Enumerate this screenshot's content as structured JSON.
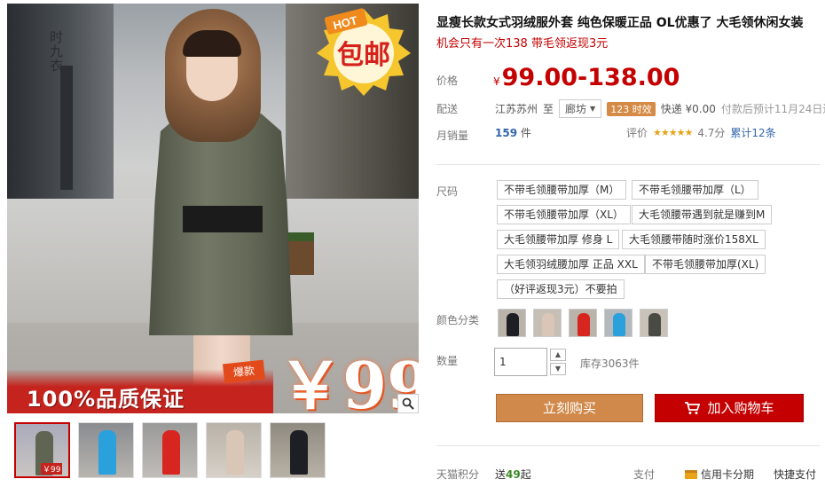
{
  "product": {
    "title": "显瘦长款女式羽绒服外套 纯色保暖正品 OL优惠了 大毛领休闲女装",
    "subtitle": "机会只有一次138 带毛领返现3元"
  },
  "image": {
    "brand_text": "时九衣",
    "hot_badge_top": "HOT",
    "hot_badge_main": "包邮",
    "price_stamp": "￥99",
    "tag_burst": "爆款",
    "quality_text": "100%品质保证",
    "zoom_icon": "magnifier-icon",
    "thumb_price": "￥99"
  },
  "price": {
    "label": "价格",
    "currency": "¥",
    "value": "99.00-138.00"
  },
  "shipping": {
    "label": "配送",
    "from": "江苏苏州",
    "to_word": "至",
    "destination": "廊坊",
    "time_badge": "123 时效",
    "express": "快递 ¥0.00",
    "eta": "付款后预计11月24日送达"
  },
  "sales": {
    "label": "月销量",
    "count": "159",
    "unit": "件"
  },
  "rating": {
    "label": "评价",
    "score": "4.7分",
    "reviews": "累计12条"
  },
  "sizes": {
    "label": "尺码",
    "options": [
      "不带毛领腰带加厚（M）",
      "不带毛领腰带加厚（L）",
      "不带毛领腰带加厚（XL）",
      "大毛领腰带遇到就是赚到M",
      "大毛领腰带加厚 修身 L",
      "大毛领腰带随时涨价158XL",
      "大毛领羽绒腰加厚 正品 XXL",
      "不带毛领腰带加厚(XL)",
      "（好评返现3元）不要拍"
    ]
  },
  "colors": {
    "label": "颜色分类",
    "swatches": [
      "#1d1f24",
      "#d9c6b6",
      "#d7261f",
      "#2aa0dc",
      "#4a4a44"
    ]
  },
  "quantity": {
    "label": "数量",
    "value": "1",
    "stock": "库存3063件"
  },
  "actions": {
    "buy_now": "立刻购买",
    "add_to_cart": "加入购物车"
  },
  "footer": {
    "points_label": "天猫积分",
    "points_prefix": "送",
    "points_value": "49",
    "points_suffix": "起",
    "pay_label": "支付",
    "credit": "信用卡分期",
    "quick_pay": "快捷支付"
  },
  "colors_ui": {
    "accent": "#c40000",
    "buy_now": "#d0894a",
    "link": "#3366aa"
  }
}
